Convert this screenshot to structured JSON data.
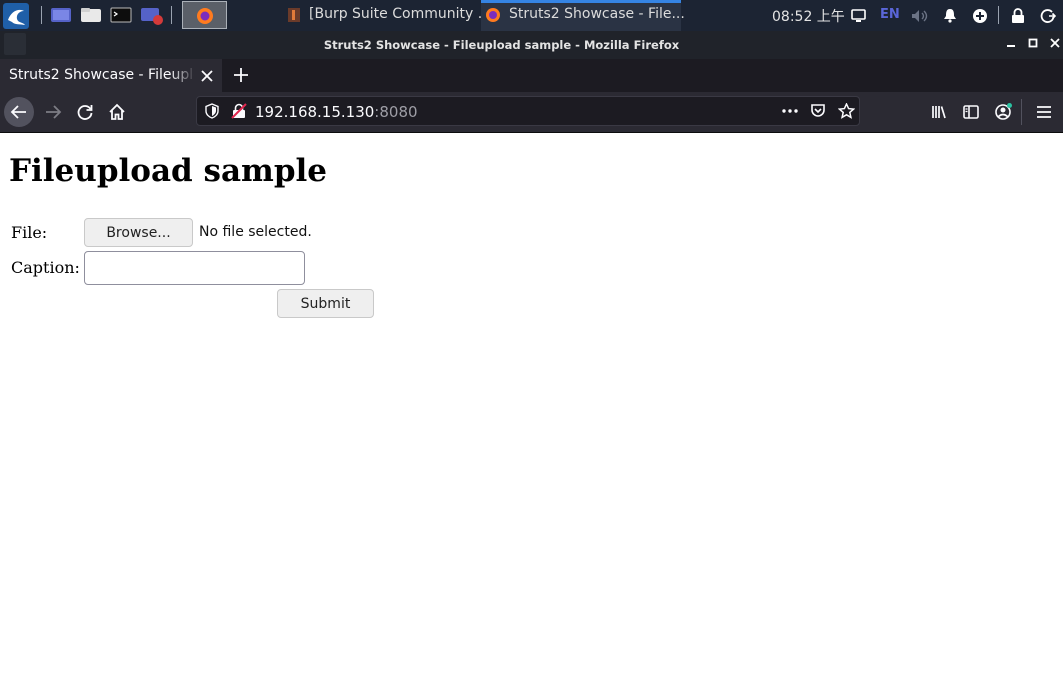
{
  "taskbar": {
    "tasks": [
      {
        "label": "[Burp Suite Community ..."
      },
      {
        "label": "Struts2 Showcase - File..."
      }
    ],
    "clock": "08:52 上午",
    "input_method": "EN",
    "colors": {
      "bg": "#1c2433",
      "active_underline": "#3584e4"
    }
  },
  "window": {
    "title": "Struts2 Showcase - Fileupload sample - Mozilla Firefox"
  },
  "browser": {
    "tab": {
      "title": "Struts2 Showcase - Fileupload sample"
    },
    "url": {
      "host": "192.168.15.130",
      "port": ":8080"
    },
    "icons": [
      "back-arrow-icon",
      "forward-arrow-icon",
      "reload-icon",
      "home-icon",
      "shield-icon",
      "insecure-lock-icon",
      "more-icon",
      "pocket-icon",
      "bookmark-star-icon",
      "library-icon",
      "sidebar-icon",
      "account-icon",
      "hamburger-menu-icon"
    ]
  },
  "page": {
    "heading": "Fileupload sample",
    "form": {
      "file_label": "File:",
      "browse_button": "Browse...",
      "file_status": "No file selected.",
      "caption_label": "Caption:",
      "caption_value": "",
      "submit_button": "Submit"
    }
  }
}
